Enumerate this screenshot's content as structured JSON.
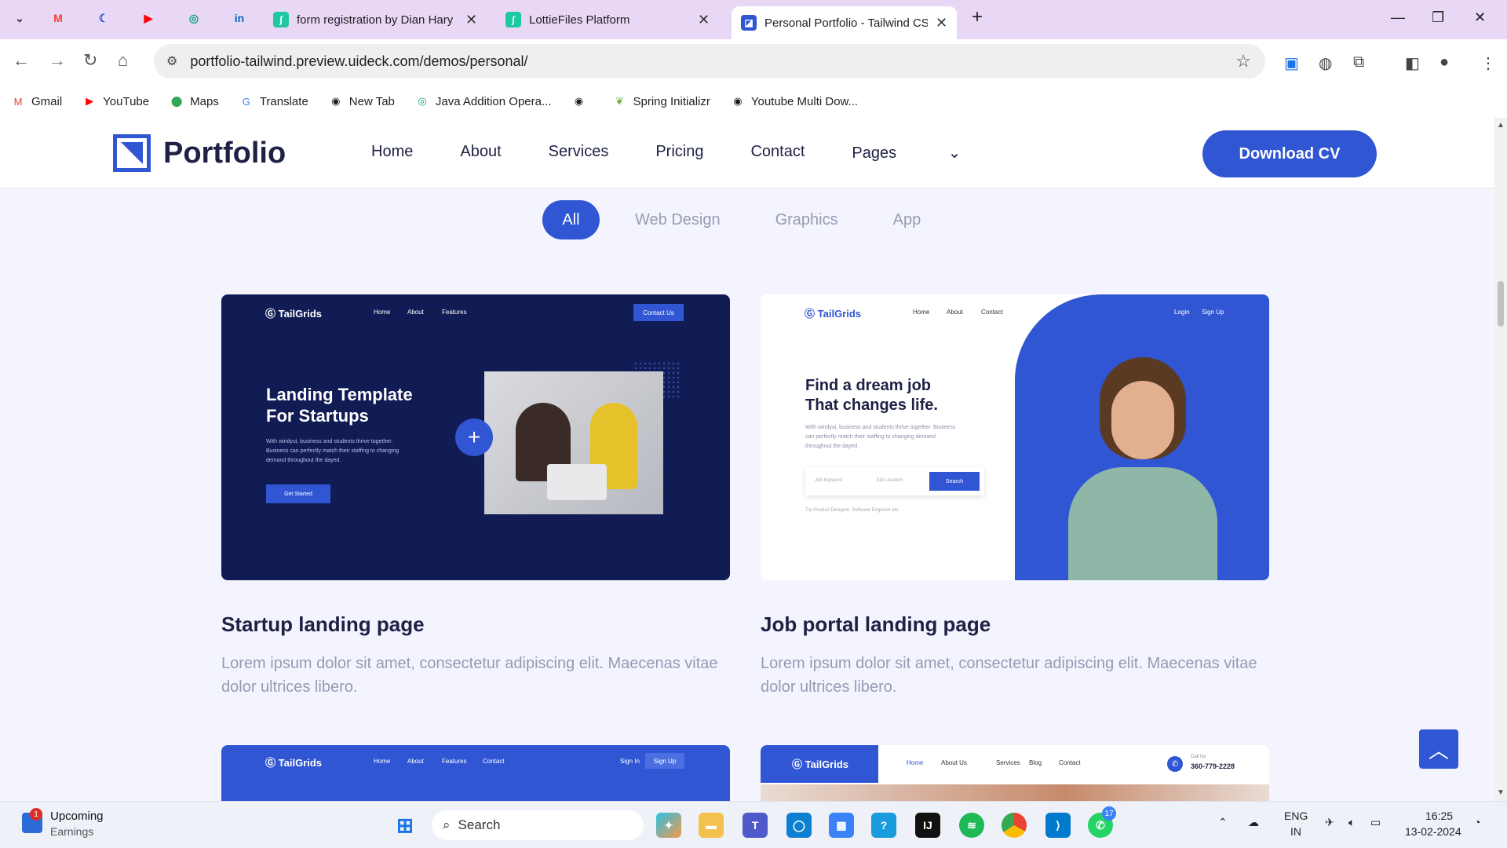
{
  "browser": {
    "tabs": [
      {
        "title": "form registration by Dian Hary",
        "icon_color": "#1ec9a2"
      },
      {
        "title": "LottieFiles Platform",
        "icon_color": "#1ec9a2"
      },
      {
        "title": "Personal Portfolio - Tailwind CSS",
        "icon_color": "#3056d3"
      }
    ],
    "url": "portfolio-tailwind.preview.uideck.com/demos/personal/",
    "bookmarks": [
      {
        "label": "Gmail",
        "icon": "gmail-icon",
        "color": "#ea4335"
      },
      {
        "label": "YouTube",
        "icon": "youtube-icon",
        "color": "#ff0000"
      },
      {
        "label": "Maps",
        "icon": "maps-icon",
        "color": "#34a853"
      },
      {
        "label": "Translate",
        "icon": "translate-icon",
        "color": "#4285f4"
      },
      {
        "label": "New Tab",
        "icon": "globe-icon",
        "color": "#333333"
      },
      {
        "label": "Java Addition Opera...",
        "icon": "chatgpt-icon",
        "color": "#10a37f"
      },
      {
        "label": "",
        "icon": "globe-icon",
        "color": "#333333"
      },
      {
        "label": "Spring Initializr",
        "icon": "spring-icon",
        "color": "#6db33f"
      },
      {
        "label": "Youtube Multi Dow...",
        "icon": "globe-icon",
        "color": "#333333"
      }
    ]
  },
  "site": {
    "logo_text": "Portfolio",
    "nav": [
      "Home",
      "About",
      "Services",
      "Pricing",
      "Contact",
      "Pages"
    ],
    "cta": "Download CV",
    "filters": [
      "All",
      "Web Design",
      "Graphics",
      "App"
    ],
    "accent": "#3056d3",
    "cards": [
      {
        "title": "Startup landing page",
        "description": "Lorem ipsum dolor sit amet, consectetur adipiscing elit. Maecenas vitae dolor ultrices libero.",
        "mock": {
          "brand": "TailGrids",
          "menu": [
            "Home",
            "About",
            "Features"
          ],
          "button": "Contact Us",
          "headline_1": "Landing Template",
          "headline_2": "For Startups",
          "body_1": "With windyui, business and students thrive together.",
          "body_2": "Business can perfectly match their staffing to changing",
          "body_3": "demand throughout the dayed.",
          "cta": "Get Started"
        }
      },
      {
        "title": "Job portal landing page",
        "description": "Lorem ipsum dolor sit amet, consectetur adipiscing elit. Maecenas vitae dolor ultrices libero.",
        "mock": {
          "brand": "TailGrids",
          "menu": [
            "Home",
            "About",
            "Contact"
          ],
          "login": "Login",
          "signup": "Sign Up",
          "headline_1": "Find a dream job",
          "headline_2": "That changes life.",
          "body_1": "With windyui, business and students thrive together. Business",
          "body_2": "can perfectly match their staffing to changing demand",
          "body_3": "throughout the dayed.",
          "field_1": "Job Keyword",
          "field_2": "Job Location",
          "search": "Search",
          "hint": "Try Product Designer, Software Engineer etc."
        }
      },
      {
        "mock": {
          "brand": "TailGrids",
          "menu": [
            "Home",
            "About",
            "Features",
            "Contact"
          ],
          "signin": "Sign In",
          "signup": "Sign Up"
        }
      },
      {
        "mock": {
          "brand": "TailGrids",
          "menu": [
            "Home",
            "About Us",
            "Services",
            "Blog",
            "Contact"
          ],
          "call_label": "Call Us",
          "phone": "360-779-2228"
        }
      }
    ]
  },
  "taskbar": {
    "widget_title": "Upcoming",
    "widget_sub": "Earnings",
    "widget_badge": "1",
    "search": "Search",
    "lang_1": "ENG",
    "lang_2": "IN",
    "time": "16:25",
    "date": "13-02-2024",
    "whatsapp_badge": "17"
  }
}
